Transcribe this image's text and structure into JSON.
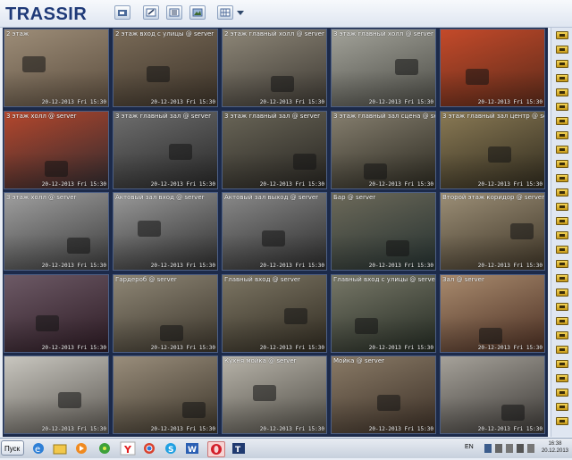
{
  "app": {
    "logo": "TRASSIR",
    "colors": {
      "logo_text": "#1f3a78",
      "logo_accent": "#d11a1a",
      "grid_bg": "#1c2a4a"
    }
  },
  "toolbar": {
    "icons": [
      "camera-settings-icon",
      "edit-icon",
      "layout-icon",
      "image-icon",
      "screen-layout-icon"
    ]
  },
  "cameras": [
    {
      "label": "2 этаж",
      "timestamp": "20-12-2013 Fri 15:30"
    },
    {
      "label": "2 этаж вход с улицы @ server",
      "timestamp": "20-12-2013 Fri 15:30"
    },
    {
      "label": "2 этаж главный холл @ server",
      "timestamp": "20-12-2013 Fri 15:30"
    },
    {
      "label": "3 этаж главный холл @ server",
      "timestamp": "20-12-2013 Fri 15:30"
    },
    {
      "label": "",
      "timestamp": "20-12-2013 Fri 15:30"
    },
    {
      "label": "3 этаж холл @ server",
      "timestamp": "20-12-2013 Fri 15:30"
    },
    {
      "label": "3 этаж главный зал @ server",
      "timestamp": "20-12-2013 Fri 15:30"
    },
    {
      "label": "3 этаж главный зал @ server",
      "timestamp": "20-12-2013 Fri 15:30"
    },
    {
      "label": "3 этаж главный зал сцена @ server",
      "timestamp": "20-12-2013 Fri 15:30"
    },
    {
      "label": "3 этаж главный зал центр @ server",
      "timestamp": "20-12-2013 Fri 15:30"
    },
    {
      "label": "3 этаж холл @ server",
      "timestamp": "20-12-2013 Fri 15:30"
    },
    {
      "label": "Актовый зал вход @ server",
      "timestamp": "20-12-2013 Fri 15:30"
    },
    {
      "label": "Актовый зал выход @ server",
      "timestamp": "20-12-2013 Fri 15:30"
    },
    {
      "label": "Бар @ server",
      "timestamp": "20-12-2013 Fri 15:30"
    },
    {
      "label": "Второй этаж коридор @ server",
      "timestamp": "20-12-2013 Fri 15:30"
    },
    {
      "label": "",
      "timestamp": "20-12-2013 Fri 15:30"
    },
    {
      "label": "Гардероб @ server",
      "timestamp": "20-12-2013 Fri 15:30"
    },
    {
      "label": "Главный вход @ server",
      "timestamp": "20-12-2013 Fri 15:30"
    },
    {
      "label": "Главный вход с улицы @ server",
      "timestamp": "20-12-2013 Fri 15:30"
    },
    {
      "label": "Зал @ server",
      "timestamp": "20-12-2013 Fri 15:30"
    },
    {
      "label": "",
      "timestamp": "20-12-2013 Fri 15:30"
    },
    {
      "label": "",
      "timestamp": "20-12-2013 Fri 15:30"
    },
    {
      "label": "Кухня мойка @ server",
      "timestamp": "20-12-2013 Fri 15:30"
    },
    {
      "label": "Мойка @ server",
      "timestamp": "20-12-2013 Fri 15:30"
    },
    {
      "label": "",
      "timestamp": "20-12-2013 Fri 15:30"
    }
  ],
  "taskbar": {
    "start_label": "Пуск",
    "apps": [
      "ie-icon",
      "folder-icon",
      "media-player-icon",
      "flower-icon",
      "yandex-icon",
      "chrome-icon",
      "skype-icon",
      "word-icon",
      "opera-icon",
      "trassir-icon"
    ],
    "lang": "EN",
    "time": "16:38",
    "date": "20.12.2013"
  }
}
